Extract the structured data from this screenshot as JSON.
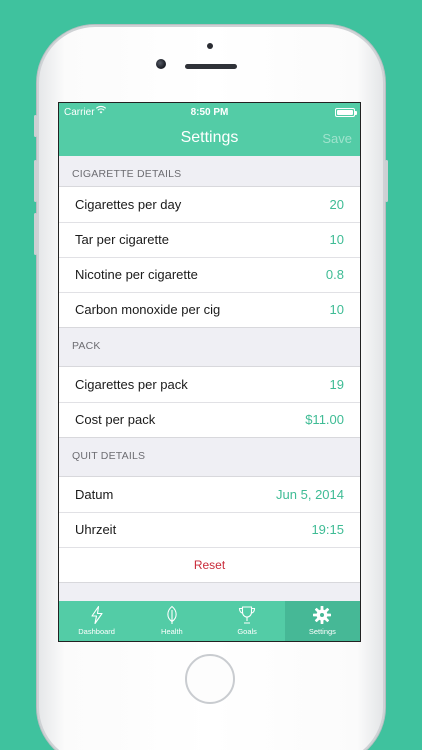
{
  "status_bar": {
    "carrier": "Carrier",
    "time": "8:50 PM"
  },
  "nav": {
    "title": "Settings",
    "save_label": "Save"
  },
  "sections": [
    {
      "header": "CIGARETTE DETAILS",
      "rows": [
        {
          "label": "Cigarettes per day",
          "value": "20"
        },
        {
          "label": "Tar per cigarette",
          "value": "10"
        },
        {
          "label": "Nicotine per cigarette",
          "value": "0.8"
        },
        {
          "label": "Carbon monoxide per cig",
          "value": "10"
        }
      ]
    },
    {
      "header": "PACK",
      "rows": [
        {
          "label": "Cigarettes per pack",
          "value": "19"
        },
        {
          "label": "Cost per pack",
          "value": "$11.00"
        }
      ]
    },
    {
      "header": "QUIT DETAILS",
      "rows": [
        {
          "label": "Datum",
          "value": "Jun 5, 2014"
        },
        {
          "label": "Uhrzeit",
          "value": "19:15"
        }
      ],
      "action": "Reset"
    }
  ],
  "tabs": [
    {
      "label": "Dashboard",
      "icon": "lightning-icon",
      "active": false
    },
    {
      "label": "Health",
      "icon": "leaf-icon",
      "active": false
    },
    {
      "label": "Goals",
      "icon": "trophy-icon",
      "active": false
    },
    {
      "label": "Settings",
      "icon": "gear-icon",
      "active": true
    }
  ],
  "colors": {
    "background": "#3fc29e",
    "accent": "#53cca6",
    "value_text": "#3fbc95",
    "destructive": "#c92b3a"
  }
}
